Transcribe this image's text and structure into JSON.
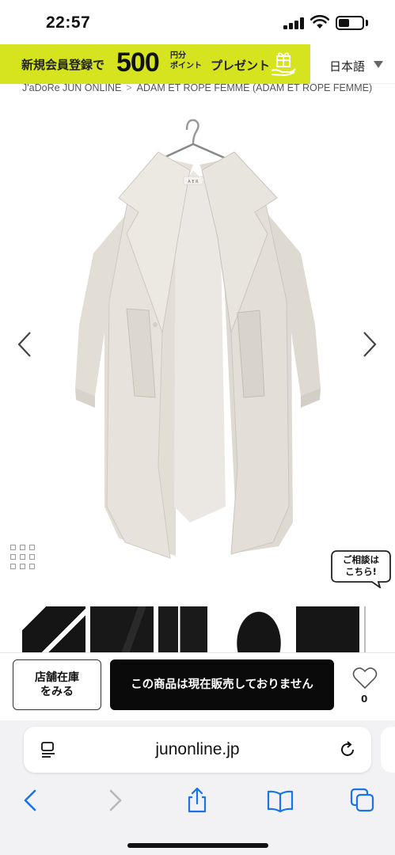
{
  "status_bar": {
    "time": "22:57"
  },
  "promo": {
    "left_text": "新規会員登録で",
    "amount": "500",
    "unit_line1": "円分",
    "unit_line2": "ポイント",
    "right_text": "プレゼント"
  },
  "language": {
    "label": "日本語"
  },
  "breadcrumb": {
    "items": [
      "J'aDoRe JUN ONLINE",
      "ADAM ET ROPE FEMME (ADAM ET ROPE FEMME)"
    ],
    "separator": ">"
  },
  "product": {
    "label_tag": "A E R",
    "coat_color": "#e4e0d9"
  },
  "consult": {
    "line1": "ご相談は",
    "line2": "こちら!"
  },
  "actions": {
    "stock_line1": "店舗在庫",
    "stock_line2": "をみる",
    "soldout_label": "この商品は現在販売しておりません",
    "favorite_count": "0"
  },
  "browser": {
    "url": "junonline.jp"
  },
  "colors": {
    "promo_bg": "#d6e41f",
    "button_dark": "#0a0a0a",
    "safari_bg": "#f2f2f4"
  }
}
